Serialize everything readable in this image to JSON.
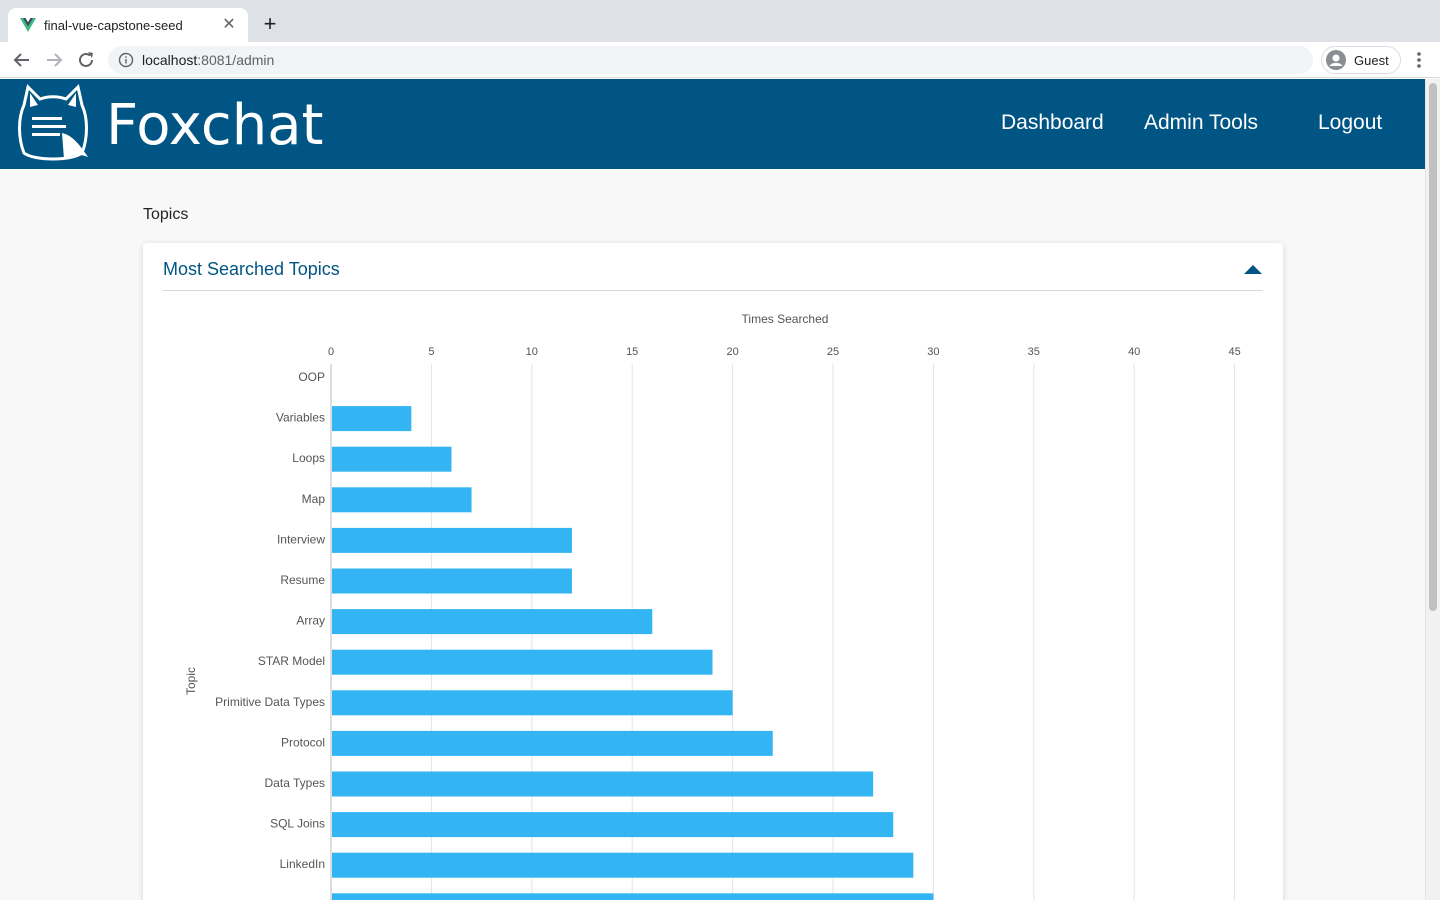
{
  "browser": {
    "tab_title": "final-vue-capstone-seed",
    "url_host": "localhost",
    "url_rest": ":8081/admin",
    "profile_label": "Guest"
  },
  "header": {
    "brand": "Foxchat",
    "nav": [
      "Dashboard",
      "Admin Tools",
      "Logout"
    ],
    "bg_color": "#005584"
  },
  "page": {
    "section_label": "Topics",
    "card_title": "Most Searched Topics"
  },
  "chart_data": {
    "type": "bar",
    "orientation": "horizontal",
    "xlabel": "Times Searched",
    "ylabel": "Topic",
    "xlim": [
      0,
      45
    ],
    "xticks": [
      0,
      5,
      10,
      15,
      20,
      25,
      30,
      35,
      40,
      45
    ],
    "categories": [
      "OOP",
      "Variables",
      "Loops",
      "Map",
      "Interview",
      "Resume",
      "Array",
      "STAR Model",
      "Primitive Data Types",
      "Protocol",
      "Data Types",
      "SQL Joins",
      "LinkedIn",
      ""
    ],
    "values": [
      0,
      4,
      6,
      7,
      12,
      12,
      16,
      19,
      20,
      22,
      27,
      28,
      29,
      30
    ],
    "bar_color": "#33b5f3",
    "grid": true,
    "axis_position": "top"
  }
}
